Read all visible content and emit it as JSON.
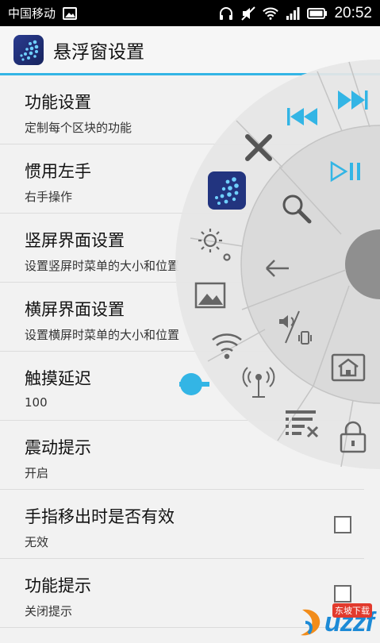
{
  "status_bar": {
    "carrier": "中国移动",
    "time": "20:52",
    "icons": [
      "image-icon",
      "headphones-icon",
      "mute-icon",
      "wifi-icon",
      "signal-icon",
      "battery-icon"
    ]
  },
  "action_bar": {
    "title": "悬浮窗设置",
    "icon": "app-icon",
    "accent": "#33b5e5"
  },
  "settings": [
    {
      "title": "功能设置",
      "subtitle": "定制每个区块的功能",
      "checkbox": null
    },
    {
      "title": "惯用左手",
      "subtitle": "右手操作",
      "checkbox": null
    },
    {
      "title": "竖屏界面设置",
      "subtitle": "设置竖屏时菜单的大小和位置",
      "checkbox": null
    },
    {
      "title": "横屏界面设置",
      "subtitle": "设置横屏时菜单的大小和位置",
      "checkbox": null
    },
    {
      "title": "触摸延迟",
      "subtitle": "100",
      "checkbox": null
    },
    {
      "title": "震动提示",
      "subtitle": "开启",
      "checkbox": true
    },
    {
      "title": "手指移出时是否有效",
      "subtitle": "无效",
      "checkbox": false
    },
    {
      "title": "功能提示",
      "subtitle": "关闭提示",
      "checkbox": false
    }
  ],
  "float_wheel": {
    "outer_icons": [
      "previous-track-icon",
      "next-track-icon",
      "close-icon",
      "app-icon",
      "brightness-icon",
      "picture-icon",
      "wifi-icon",
      "hotspot-icon",
      "task-clear-icon",
      "lock-icon"
    ],
    "inner_icons": [
      "play-pause-icon",
      "search-icon",
      "back-icon",
      "sound-vibrate-icon",
      "home-icon"
    ]
  },
  "watermark": {
    "text": "uzzf",
    "badge": "东坡下载"
  }
}
